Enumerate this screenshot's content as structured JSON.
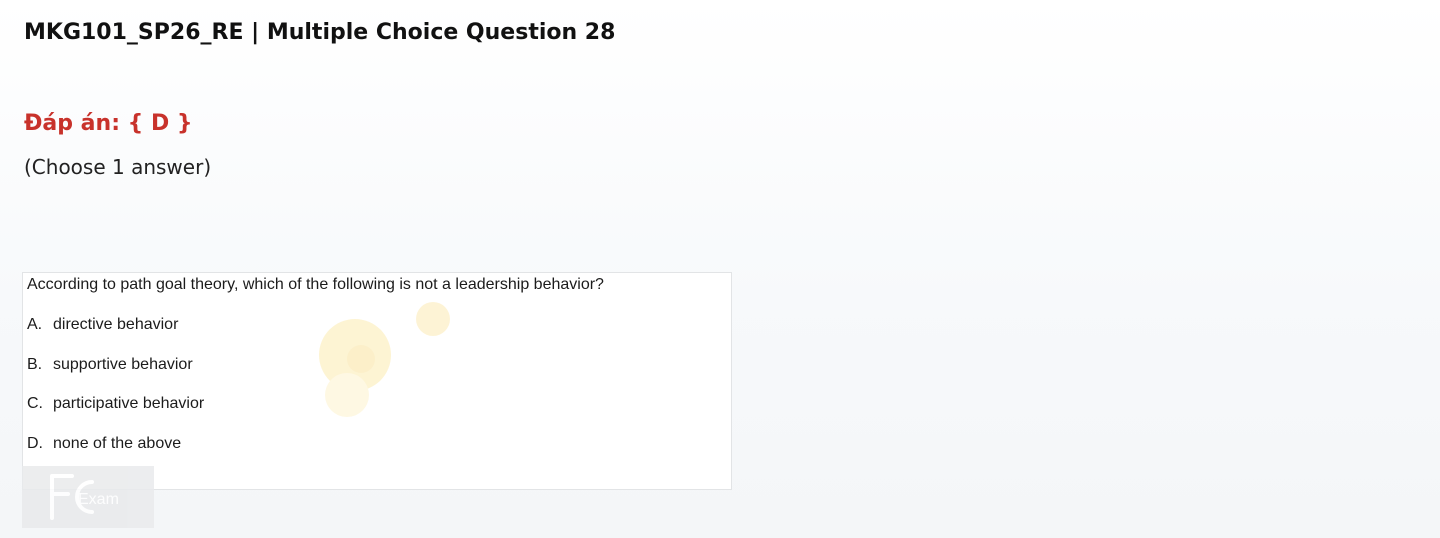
{
  "header": {
    "title": "MKG101_SP26_RE | Multiple Choice Question 28"
  },
  "answer": {
    "label": "Đáp án: { D }"
  },
  "instruction": "(Choose 1 answer)",
  "question": {
    "text": "According to path goal theory, which of the following is not a leadership behavior?",
    "options": [
      {
        "letter": "A.",
        "text": "directive behavior"
      },
      {
        "letter": "B.",
        "text": "supportive behavior"
      },
      {
        "letter": "C.",
        "text": "participative behavior"
      },
      {
        "letter": "D.",
        "text": "none of the above"
      }
    ]
  },
  "watermark": {
    "logo_text": "Exam",
    "icon": "fexam-logo-icon"
  },
  "colors": {
    "answer": "#c8322b",
    "title": "#111111"
  }
}
